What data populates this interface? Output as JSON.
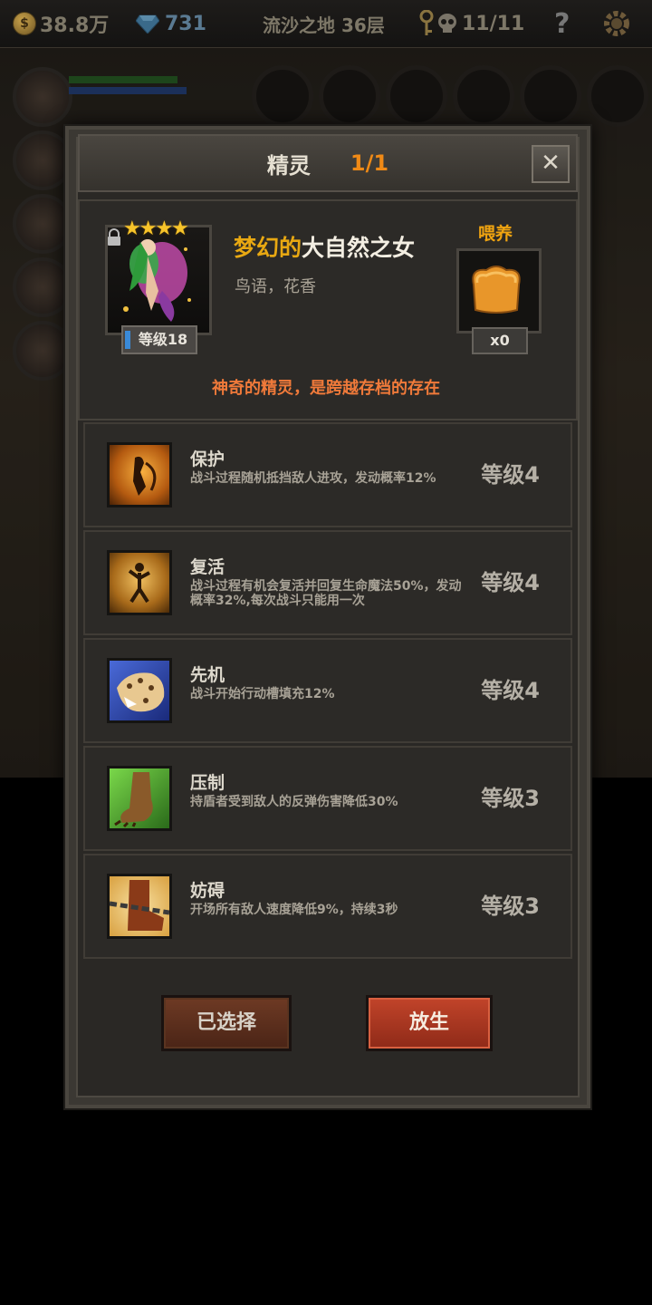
{
  "topbar": {
    "gold": "38.8万",
    "gems": "731",
    "location": "流沙之地 36层",
    "keys_skulls": "11/11",
    "help_label": "?"
  },
  "modal": {
    "title": "精灵",
    "count": "1/1",
    "close_label": "✕"
  },
  "hero": {
    "stars": "★★★★",
    "name_adjective": "梦幻的",
    "name_noun": "大自然之女",
    "subtitle": "鸟语，花香",
    "level": "等级18",
    "feed_label": "喂养",
    "feed_count": "x0",
    "description": "神奇的精灵，是跨越存档的存在"
  },
  "skills": [
    {
      "name": "保护",
      "desc": "战斗过程随机抵挡敌人进攻，发动概率12%",
      "level": "等级4",
      "icon": "shield-spirit-icon"
    },
    {
      "name": "复活",
      "desc": "战斗过程有机会复活并回复生命魔法50%，发动概率32%,每次战斗只能用一次",
      "level": "等级4",
      "icon": "revive-icon"
    },
    {
      "name": "先机",
      "desc": "战斗开始行动槽填充12%",
      "level": "等级4",
      "icon": "leopard-icon"
    },
    {
      "name": "压制",
      "desc": "持盾者受到敌人的反弹伤害降低30%",
      "level": "等级3",
      "icon": "beast-claw-icon"
    },
    {
      "name": "妨碍",
      "desc": "开场所有敌人速度降低9%，持续3秒",
      "level": "等级3",
      "icon": "chain-boot-icon"
    }
  ],
  "buttons": {
    "selected": "已选择",
    "release": "放生"
  },
  "colors": {
    "accent_orange": "#f08a16",
    "name_gold": "#e8a812",
    "desc_orange": "#f07a3a",
    "release_red": "#c2442a"
  }
}
